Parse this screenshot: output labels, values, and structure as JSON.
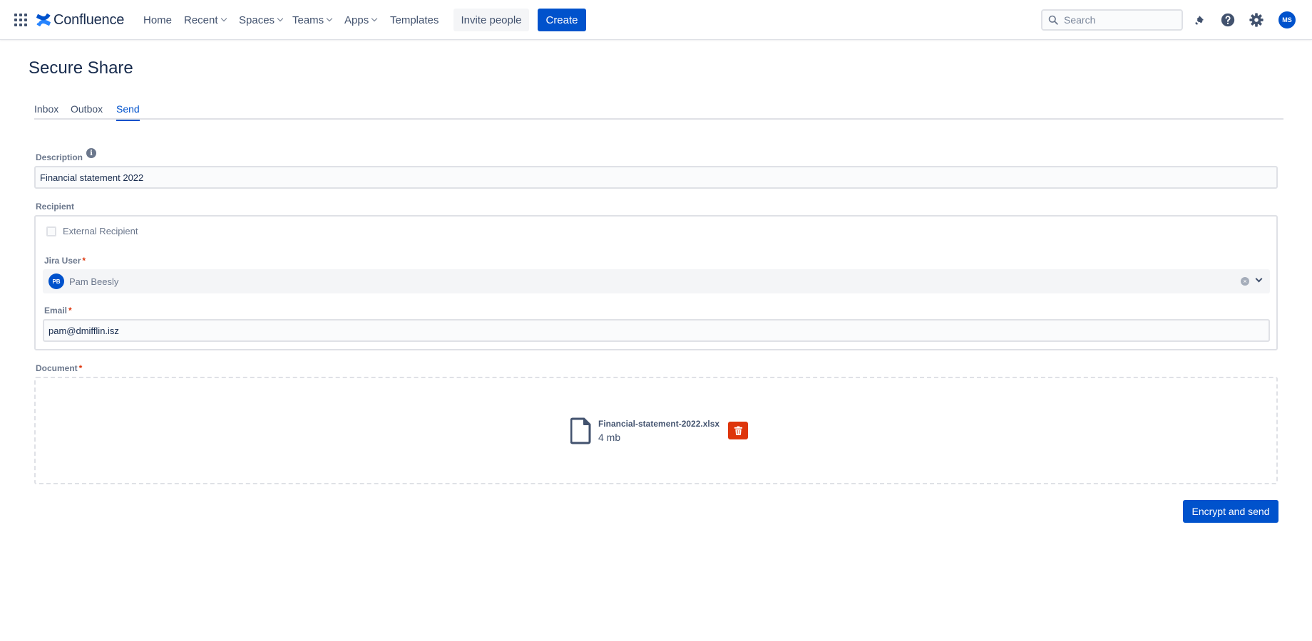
{
  "nav": {
    "logo_text": "Confluence",
    "items": [
      {
        "label": "Home",
        "dropdown": false
      },
      {
        "label": "Recent",
        "dropdown": true
      },
      {
        "label": "Spaces",
        "dropdown": true
      },
      {
        "label": "Teams",
        "dropdown": true
      },
      {
        "label": "Apps",
        "dropdown": true
      },
      {
        "label": "Templates",
        "dropdown": false
      }
    ],
    "invite_label": "Invite people",
    "create_label": "Create",
    "search_placeholder": "Search",
    "avatar_initials": "MS"
  },
  "page": {
    "title": "Secure Share",
    "tabs": [
      {
        "label": "Inbox",
        "active": false
      },
      {
        "label": "Outbox",
        "active": false
      },
      {
        "label": "Send",
        "active": true
      }
    ]
  },
  "form": {
    "description_label": "Description",
    "description_value": "Financial statement 2022",
    "recipient_label": "Recipient",
    "external_recipient_label": "External Recipient",
    "external_recipient_checked": false,
    "jira_user_label": "Jira User",
    "jira_user_value": "Pam Beesly",
    "jira_user_initials": "PB",
    "email_label": "Email",
    "email_value": "pam@dmifflin.isz",
    "required_mark": "*",
    "document_label": "Document",
    "file_name": "Financial-statement-2022.xlsx",
    "file_size": "4 mb",
    "submit_label": "Encrypt and send"
  },
  "colors": {
    "primary": "#0052cc",
    "danger": "#de350b",
    "text": "#172b4d",
    "subtle": "#6b778c"
  }
}
